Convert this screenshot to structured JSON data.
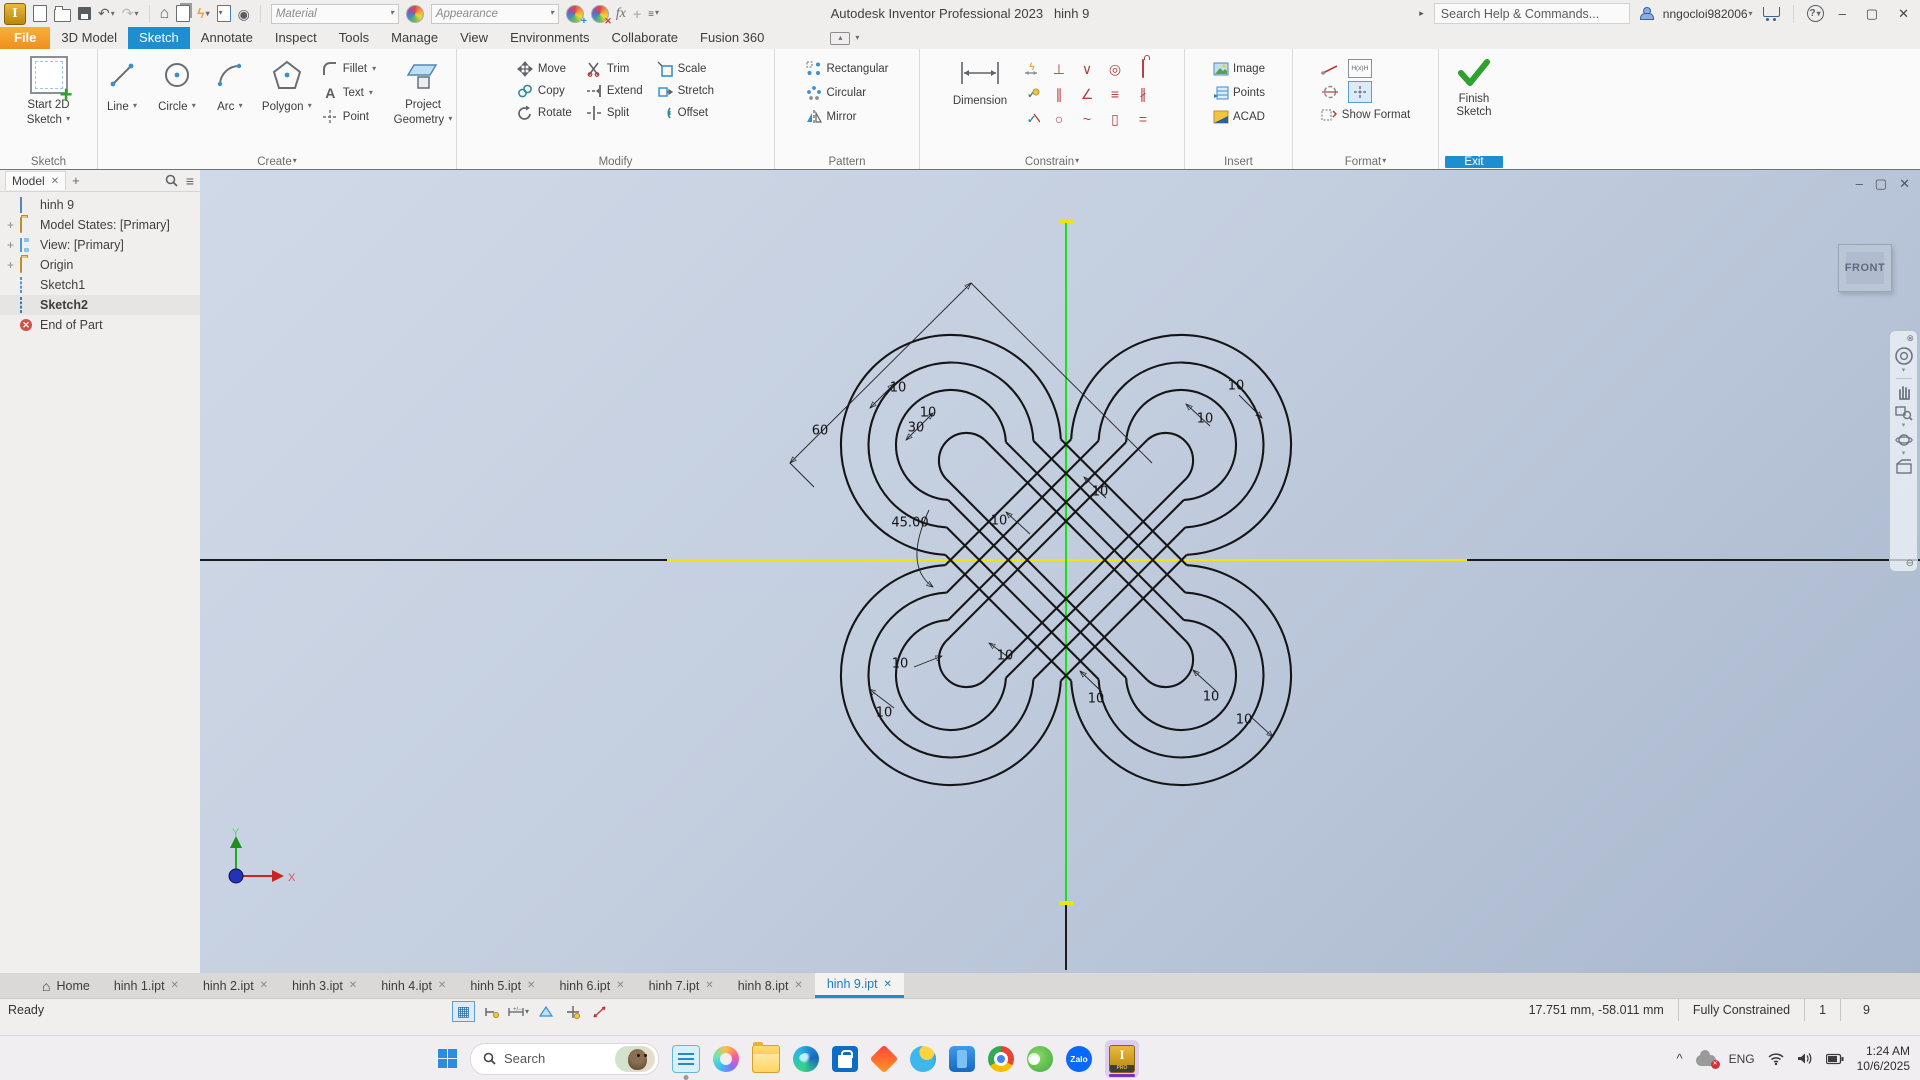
{
  "icons": {
    "close": "✕",
    "menu": "≡",
    "home": "⌂",
    "plus": "+",
    "min": "–",
    "max": "▢",
    "undo": "↶",
    "redo": "↷",
    "bolt": "ϟ",
    "question": "?",
    "chevron_up": "^",
    "arrow_right": "▸",
    "text_a": "A",
    "search_q": "Q"
  },
  "titlebar": {
    "material": "Material",
    "appearance": "Appearance",
    "fx": "fx",
    "app_title": "Autodesk Inventor Professional 2023",
    "doc_title": "hinh 9",
    "search_placeholder": "Search Help & Commands...",
    "user": "nngocloi982006"
  },
  "tabs": {
    "items": [
      "File",
      "3D Model",
      "Sketch",
      "Annotate",
      "Inspect",
      "Tools",
      "Manage",
      "View",
      "Environments",
      "Collaborate",
      "Fusion 360"
    ]
  },
  "ribbon": {
    "sketch": {
      "button": "Start 2D Sketch",
      "label": "Sketch"
    },
    "create": {
      "line": "Line",
      "circle": "Circle",
      "arc": "Arc",
      "polygon": "Polygon",
      "fillet": "Fillet",
      "text": "Text",
      "point": "Point",
      "project1": "Project",
      "project2": "Geometry",
      "label": "Create"
    },
    "modify": {
      "items": [
        "Move",
        "Copy",
        "Rotate",
        "Trim",
        "Extend",
        "Split",
        "Scale",
        "Stretch",
        "Offset"
      ],
      "label": "Modify"
    },
    "pattern": {
      "items": [
        "Rectangular",
        "Circular",
        "Mirror"
      ],
      "label": "Pattern"
    },
    "constrain": {
      "dimension": "Dimension",
      "label": "Constrain"
    },
    "insert": {
      "items": [
        "Image",
        "Points",
        "ACAD"
      ],
      "label": "Insert"
    },
    "format": {
      "show_format": "Show Format",
      "fx_icon": "H(x)H",
      "label": "Format"
    },
    "exit": {
      "button1": "Finish",
      "button2": "Sketch",
      "label": "Exit"
    }
  },
  "browser": {
    "tab": "Model",
    "items": [
      "hinh 9",
      "Model States: [Primary]",
      "View: [Primary]",
      "Origin",
      "Sketch1",
      "Sketch2",
      "End of Part"
    ]
  },
  "canvas": {
    "view_cube": "FRONT",
    "x_label": "X",
    "y_label": "Y",
    "dims": {
      "d60": "60",
      "d30": "30",
      "d45": "45.00",
      "d10": "10"
    }
  },
  "doctabs": {
    "home": "Home",
    "items": [
      "hinh 1.ipt",
      "hinh 2.ipt",
      "hinh 3.ipt",
      "hinh 4.ipt",
      "hinh 5.ipt",
      "hinh 6.ipt",
      "hinh 7.ipt",
      "hinh 8.ipt",
      "hinh 9.ipt"
    ]
  },
  "status": {
    "ready": "Ready",
    "coords": "17.751 mm, -58.011 mm",
    "constraint_state": "Fully Constrained",
    "dof": "1",
    "sketch_num": "9"
  },
  "taskbar": {
    "search": "Search",
    "zalo": "Zalo",
    "pro": "PRO",
    "inventor_i": "I",
    "lang": "ENG",
    "time": "1:24 AM",
    "date": "10/6/2025"
  }
}
